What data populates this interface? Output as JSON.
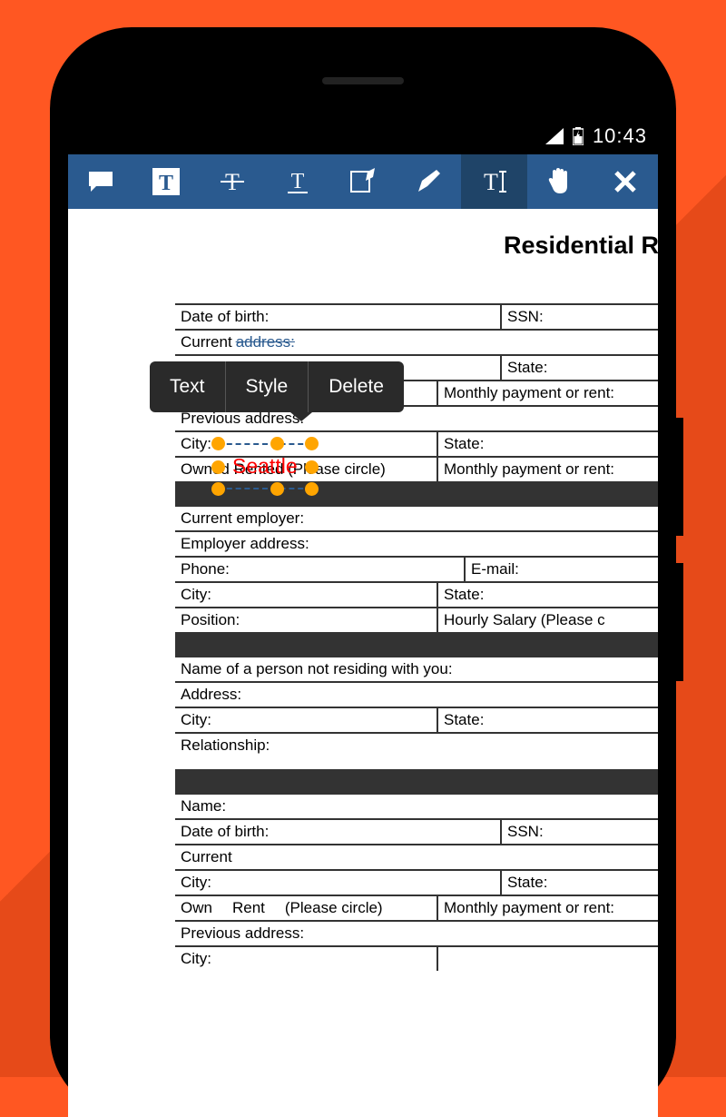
{
  "statusbar": {
    "time": "10:43"
  },
  "popup": {
    "text": "Text",
    "style": "Style",
    "delete": "Delete"
  },
  "annotation": {
    "value": "Seattle"
  },
  "title": "Residential Ren",
  "rows": {
    "dob": "Date of birth:",
    "ssn": "SSN:",
    "curaddr": "Current",
    "curaddr2": "address:",
    "city": "City:",
    "state": "State:",
    "ownrent1a": "Own",
    "ownrent1b": "Rent",
    "ownrent1c": "(Pleas",
    "ownrent1d": "circle)",
    "monthly": "Monthly payment or rent:",
    "prevaddr": "Previous address:",
    "ownrent2": "Owned    Rented    (Please circle)",
    "curemp": "Current employer:",
    "empaddr": "Employer address:",
    "phone": "Phone:",
    "email": "E-mail:",
    "position": "Position:",
    "hourlysalary": "Hourly     Salary    (Please c",
    "nameperson": "Name of a person not residing with you:",
    "address": "Address:",
    "relationship": "Relationship:",
    "name": "Name:"
  }
}
